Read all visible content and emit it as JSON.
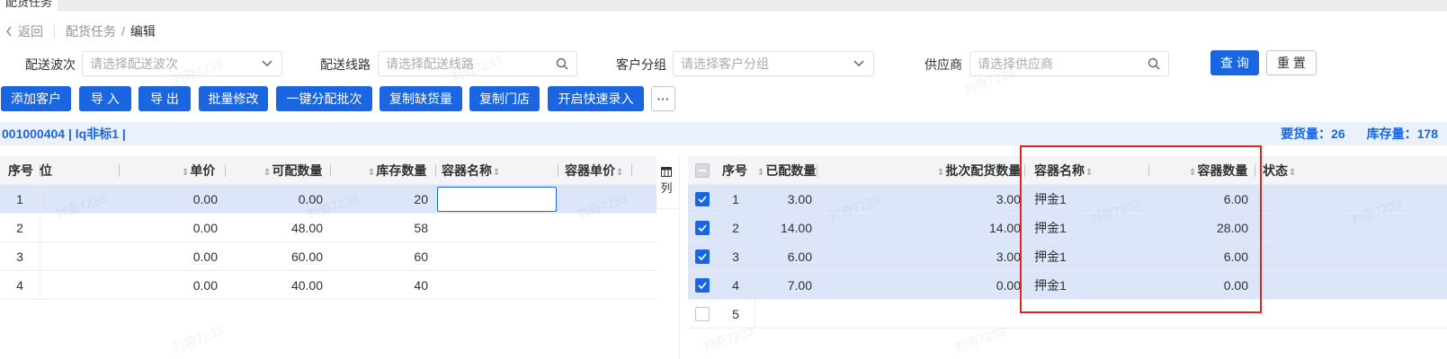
{
  "tab": {
    "label": "配货任务"
  },
  "breadcrumb": {
    "back": "返回",
    "parent": "配货任务",
    "separator": "/",
    "current": "编辑"
  },
  "filters": {
    "wave": {
      "label": "配送波次",
      "placeholder": "请选择配送波次"
    },
    "route": {
      "label": "配送线路",
      "placeholder": "请选择配送线路"
    },
    "customer_group": {
      "label": "客户分组",
      "placeholder": "请选择客户分组"
    },
    "supplier": {
      "label": "供应商",
      "placeholder": "请选择供应商"
    },
    "query_label": "查 询",
    "reset_label": "重 置"
  },
  "toolbar": {
    "add_customer": "添加客户",
    "import": "导 入",
    "export": "导 出",
    "batch_edit": "批量修改",
    "one_click_assign": "一键分配批次",
    "copy_shortage": "复制缺货量",
    "copy_store": "复制门店",
    "quick_entry": "开启快速录入",
    "more": "···"
  },
  "info_bar": {
    "item_text": "001000404 | lq非标1 |",
    "required_label": "要货量：",
    "required_value": "26",
    "stock_label": "库存量：",
    "stock_value": "178"
  },
  "left_table": {
    "headers": {
      "seq": "序号",
      "unit_partial": "位",
      "price": "单价",
      "available": "可配数量",
      "stock": "库存数量",
      "container_name": "容器名称",
      "container_price": "容器单价"
    },
    "rows": [
      {
        "seq": "1",
        "price": "0.00",
        "available": "0.00",
        "stock": "20"
      },
      {
        "seq": "2",
        "price": "0.00",
        "available": "48.00",
        "stock": "58"
      },
      {
        "seq": "3",
        "price": "0.00",
        "available": "60.00",
        "stock": "60"
      },
      {
        "seq": "4",
        "price": "0.00",
        "available": "40.00",
        "stock": "40"
      }
    ]
  },
  "column_settings": {
    "label": "列"
  },
  "right_table": {
    "headers": {
      "seq": "序号",
      "assigned": "已配数量",
      "batch_qty": "批次配货数量",
      "container_name": "容器名称",
      "container_qty": "容器数量",
      "status": "状态"
    },
    "rows": [
      {
        "seq": "1",
        "assigned": "3.00",
        "batch_qty": "3.00",
        "container_name": "押金1",
        "container_qty": "6.00",
        "checked": true
      },
      {
        "seq": "2",
        "assigned": "14.00",
        "batch_qty": "14.00",
        "container_name": "押金1",
        "container_qty": "28.00",
        "checked": true
      },
      {
        "seq": "3",
        "assigned": "6.00",
        "batch_qty": "3.00",
        "container_name": "押金1",
        "container_qty": "6.00",
        "checked": true
      },
      {
        "seq": "4",
        "assigned": "7.00",
        "batch_qty": "0.00",
        "container_name": "押金1",
        "container_qty": "0.00",
        "checked": true
      },
      {
        "seq": "5",
        "assigned": "",
        "batch_qty": "",
        "container_name": "",
        "container_qty": "",
        "checked": false
      }
    ]
  },
  "watermark": "刘奇7233",
  "colors": {
    "primary": "#1a66e0",
    "info_bg": "#eaf1fd",
    "selected_row": "#dde6f9",
    "annotation": "#e02424"
  }
}
